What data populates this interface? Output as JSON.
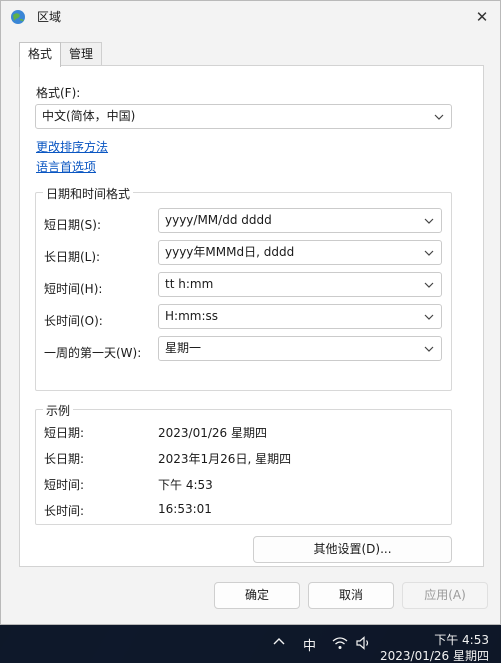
{
  "window": {
    "title": "区域"
  },
  "tabs": [
    {
      "label": "格式",
      "active": true
    },
    {
      "label": "管理",
      "active": false
    }
  ],
  "format": {
    "label": "格式(F):",
    "value": "中文(简体，中国)"
  },
  "links": {
    "sort": "更改排序方法",
    "language": "语言首选项"
  },
  "datetime_group": {
    "title": "日期和时间格式",
    "rows": [
      {
        "label": "短日期(S):",
        "value": "yyyy/MM/dd dddd"
      },
      {
        "label": "长日期(L):",
        "value": "yyyy年MMMd日, dddd"
      },
      {
        "label": "短时间(H):",
        "value": "tt h:mm"
      },
      {
        "label": "长时间(O):",
        "value": "H:mm:ss"
      },
      {
        "label": "一周的第一天(W):",
        "value": "星期一"
      }
    ]
  },
  "example_group": {
    "title": "示例",
    "rows": [
      {
        "label": "短日期:",
        "value": "2023/01/26 星期四"
      },
      {
        "label": "长日期:",
        "value": "2023年1月26日, 星期四"
      },
      {
        "label": "短时间:",
        "value": "下午 4:53"
      },
      {
        "label": "长时间:",
        "value": "16:53:01"
      }
    ]
  },
  "buttons": {
    "other_settings": "其他设置(D)...",
    "ok": "确定",
    "cancel": "取消",
    "apply": "应用(A)"
  },
  "taskbar": {
    "ime": "中",
    "time": "下午 4:53",
    "date": "2023/01/26 星期四"
  },
  "colors": {
    "link": "#0a56c2",
    "window_bg": "#f3f3f3",
    "panel_bg": "#ffffff"
  }
}
